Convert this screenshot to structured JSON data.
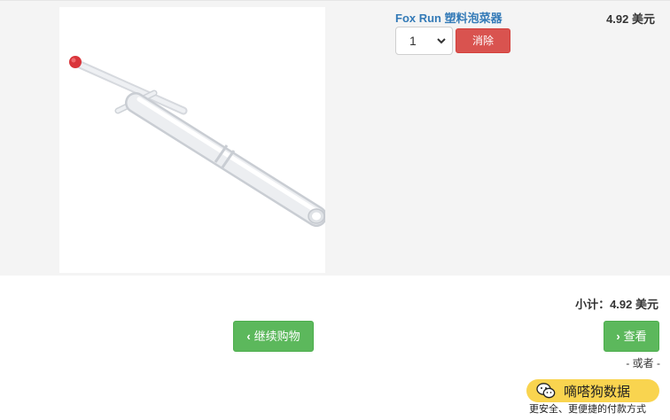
{
  "cart": {
    "item": {
      "name": "Fox Run 塑料泡菜器",
      "quantity": "1",
      "remove_label": "消除",
      "price": "4.92 美元",
      "image_alt": "white plastic pickle picker with red tip"
    },
    "subtotal": "小计：4.92 美元"
  },
  "actions": {
    "continue_label": "继续购物",
    "checkout_label": "查看",
    "or_label": "- 或者 -"
  },
  "badge": {
    "text": "嘀嗒狗数据",
    "note": "更安全、更便捷的付款方式"
  },
  "colors": {
    "link": "#337ab7",
    "danger": "#d9534f",
    "success": "#5cb85c",
    "badge": "#f9d44f"
  },
  "icons": {
    "qty_chevron": "chevron-down-icon",
    "continue": "chevron-left-icon",
    "checkout": "chevron-right-icon",
    "badge": "wechat-icon"
  }
}
